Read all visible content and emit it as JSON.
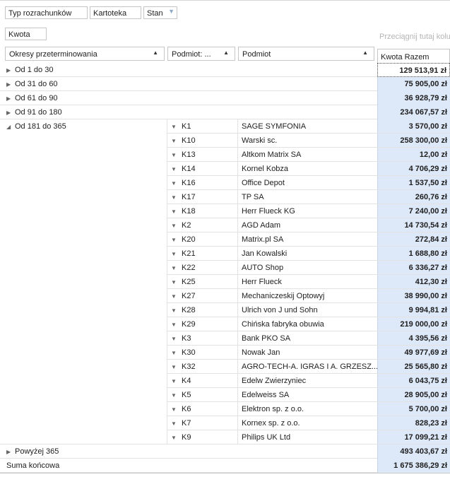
{
  "filters": [
    "Typ rozrachunków",
    "Kartoteka",
    "Stan"
  ],
  "data_field": "Kwota",
  "drop_hint": "Przeciągnij tutaj kolu",
  "row_headers": [
    "Okresy przeterminowania",
    "Podmiot: ...",
    "Podmiot"
  ],
  "data_header": "Kwota Razem",
  "groups_before": [
    {
      "label": "Od 1 do 30",
      "value": "129 513,91 zł"
    },
    {
      "label": "Od 31 do 60",
      "value": "75 905,00 zł"
    },
    {
      "label": "Od 61 do 90",
      "value": "36 928,79 zł"
    },
    {
      "label": "Od 91 do 180",
      "value": "234 067,57 zł"
    }
  ],
  "open_group": {
    "label": "Od 181 do 365",
    "rows": [
      {
        "code": "K1",
        "name": "SAGE SYMFONIA",
        "value": "3 570,00 zł"
      },
      {
        "code": "K10",
        "name": "Warski sc.",
        "value": "258 300,00 zł"
      },
      {
        "code": "K13",
        "name": "Altkom Matrix SA",
        "value": "12,00 zł"
      },
      {
        "code": "K14",
        "name": "Kornel Kobza",
        "value": "4 706,29 zł"
      },
      {
        "code": "K16",
        "name": "Office Depot",
        "value": "1 537,50 zł"
      },
      {
        "code": "K17",
        "name": "TP SA",
        "value": "260,76 zł"
      },
      {
        "code": "K18",
        "name": "Herr Flueck KG",
        "value": "7 240,00 zł"
      },
      {
        "code": "K2",
        "name": "AGD Adam",
        "value": "14 730,54 zł"
      },
      {
        "code": "K20",
        "name": "Matrix.pl SA",
        "value": "272,84 zł"
      },
      {
        "code": "K21",
        "name": "Jan Kowalski",
        "value": "1 688,80 zł"
      },
      {
        "code": "K22",
        "name": "AUTO Shop",
        "value": "6 336,27 zł"
      },
      {
        "code": "K25",
        "name": "Herr Flueck",
        "value": "412,30 zł"
      },
      {
        "code": "K27",
        "name": "Mechaniczeskij Optowyj",
        "value": "38 990,00 zł"
      },
      {
        "code": "K28",
        "name": "Ulrich von J und Sohn",
        "value": "9 994,81 zł"
      },
      {
        "code": "K29",
        "name": "Chińska fabryka obuwia",
        "value": "219 000,00 zł"
      },
      {
        "code": "K3",
        "name": "Bank PKO SA",
        "value": "4 395,56 zł"
      },
      {
        "code": "K30",
        "name": "Nowak Jan",
        "value": "49 977,69 zł"
      },
      {
        "code": "K32",
        "name": "AGRO-TECH-A. IGRAS I A. GRZESZ...",
        "value": "25 565,80 zł"
      },
      {
        "code": "K4",
        "name": "Edelw Zwierzyniec",
        "value": "6 043,75 zł"
      },
      {
        "code": "K5",
        "name": "Edelweiss SA",
        "value": "28 905,00 zł"
      },
      {
        "code": "K6",
        "name": "Elektron sp. z o.o.",
        "value": "5 700,00 zł"
      },
      {
        "code": "K7",
        "name": "Kornex sp. z o.o.",
        "value": "828,23 zł"
      },
      {
        "code": "K9",
        "name": "Philips UK Ltd",
        "value": "17 099,21 zł"
      }
    ]
  },
  "groups_after": [
    {
      "label": "Powyżej 365",
      "value": "493 403,67 zł"
    }
  ],
  "grand_total": {
    "label": "Suma końcowa",
    "value": "1 675 386,29 zł"
  },
  "colors": {
    "value_column_bg": "#dde8f8",
    "border": "#c6c6c6",
    "hint": "#b5b5b5"
  }
}
